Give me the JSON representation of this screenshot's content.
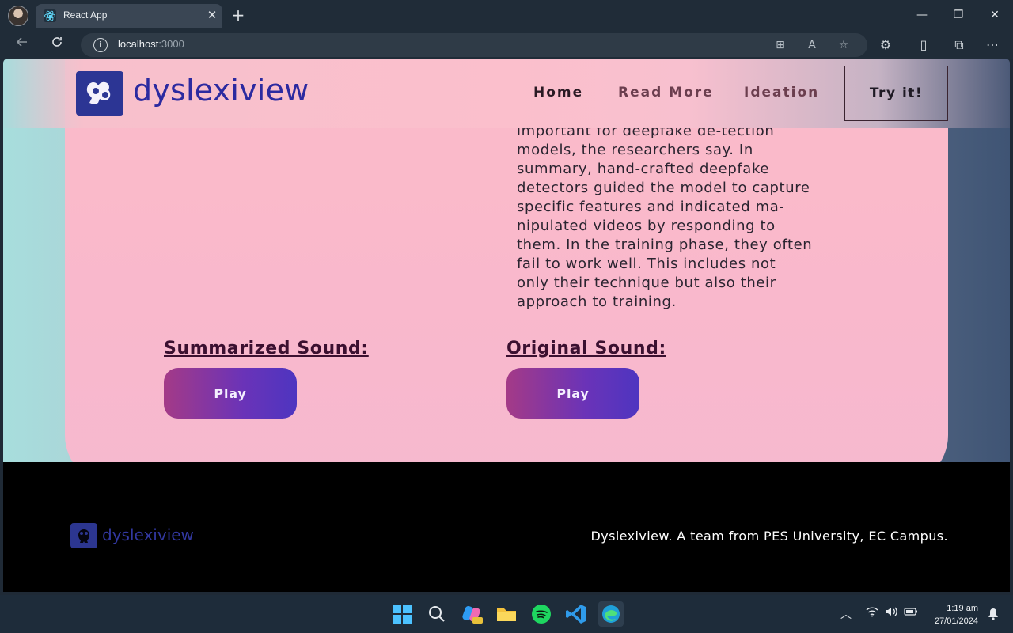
{
  "browser": {
    "tab_title": "React App",
    "tab_close": "✕",
    "new_tab": "+",
    "window_controls": {
      "minimize": "—",
      "restore": "❐",
      "close": "✕"
    },
    "address_host": "localhost",
    "address_port": ":3000"
  },
  "navbar": {
    "logo_text": "dyslexiview",
    "links": [
      "Home",
      "Read More",
      "Ideation"
    ],
    "link_colors": [
      "#2a1a24",
      "#6b3e4e",
      "#6b3e4e"
    ],
    "cta": "Try it!"
  },
  "article": {
    "lines": [
      "important for deepfake de-tection",
      "models, the researchers say. In",
      "summary, hand-crafted deepfake",
      "detectors guided the model to capture",
      "specific features and indicated ma-",
      "nipulated videos by responding to",
      "them. In the training phase, they often",
      "fail to work well. This includes not",
      "only their technique but also their",
      "approach to training."
    ]
  },
  "sounds": {
    "summarized_label": "Summarized Sound:",
    "original_label": "Original Sound:",
    "play_label": "Play"
  },
  "footer": {
    "logo_text": "dyslexiview",
    "text": "Dyslexiview. A team from PES University, EC Campus."
  },
  "taskbar": {
    "time": "1:19 am",
    "date": "27/01/2024"
  },
  "colors": {
    "accent": "#2c3594",
    "play_gradient_start": "#a43a87",
    "play_gradient_end": "#4e35c0",
    "card_pink": "#f9b8cc"
  }
}
